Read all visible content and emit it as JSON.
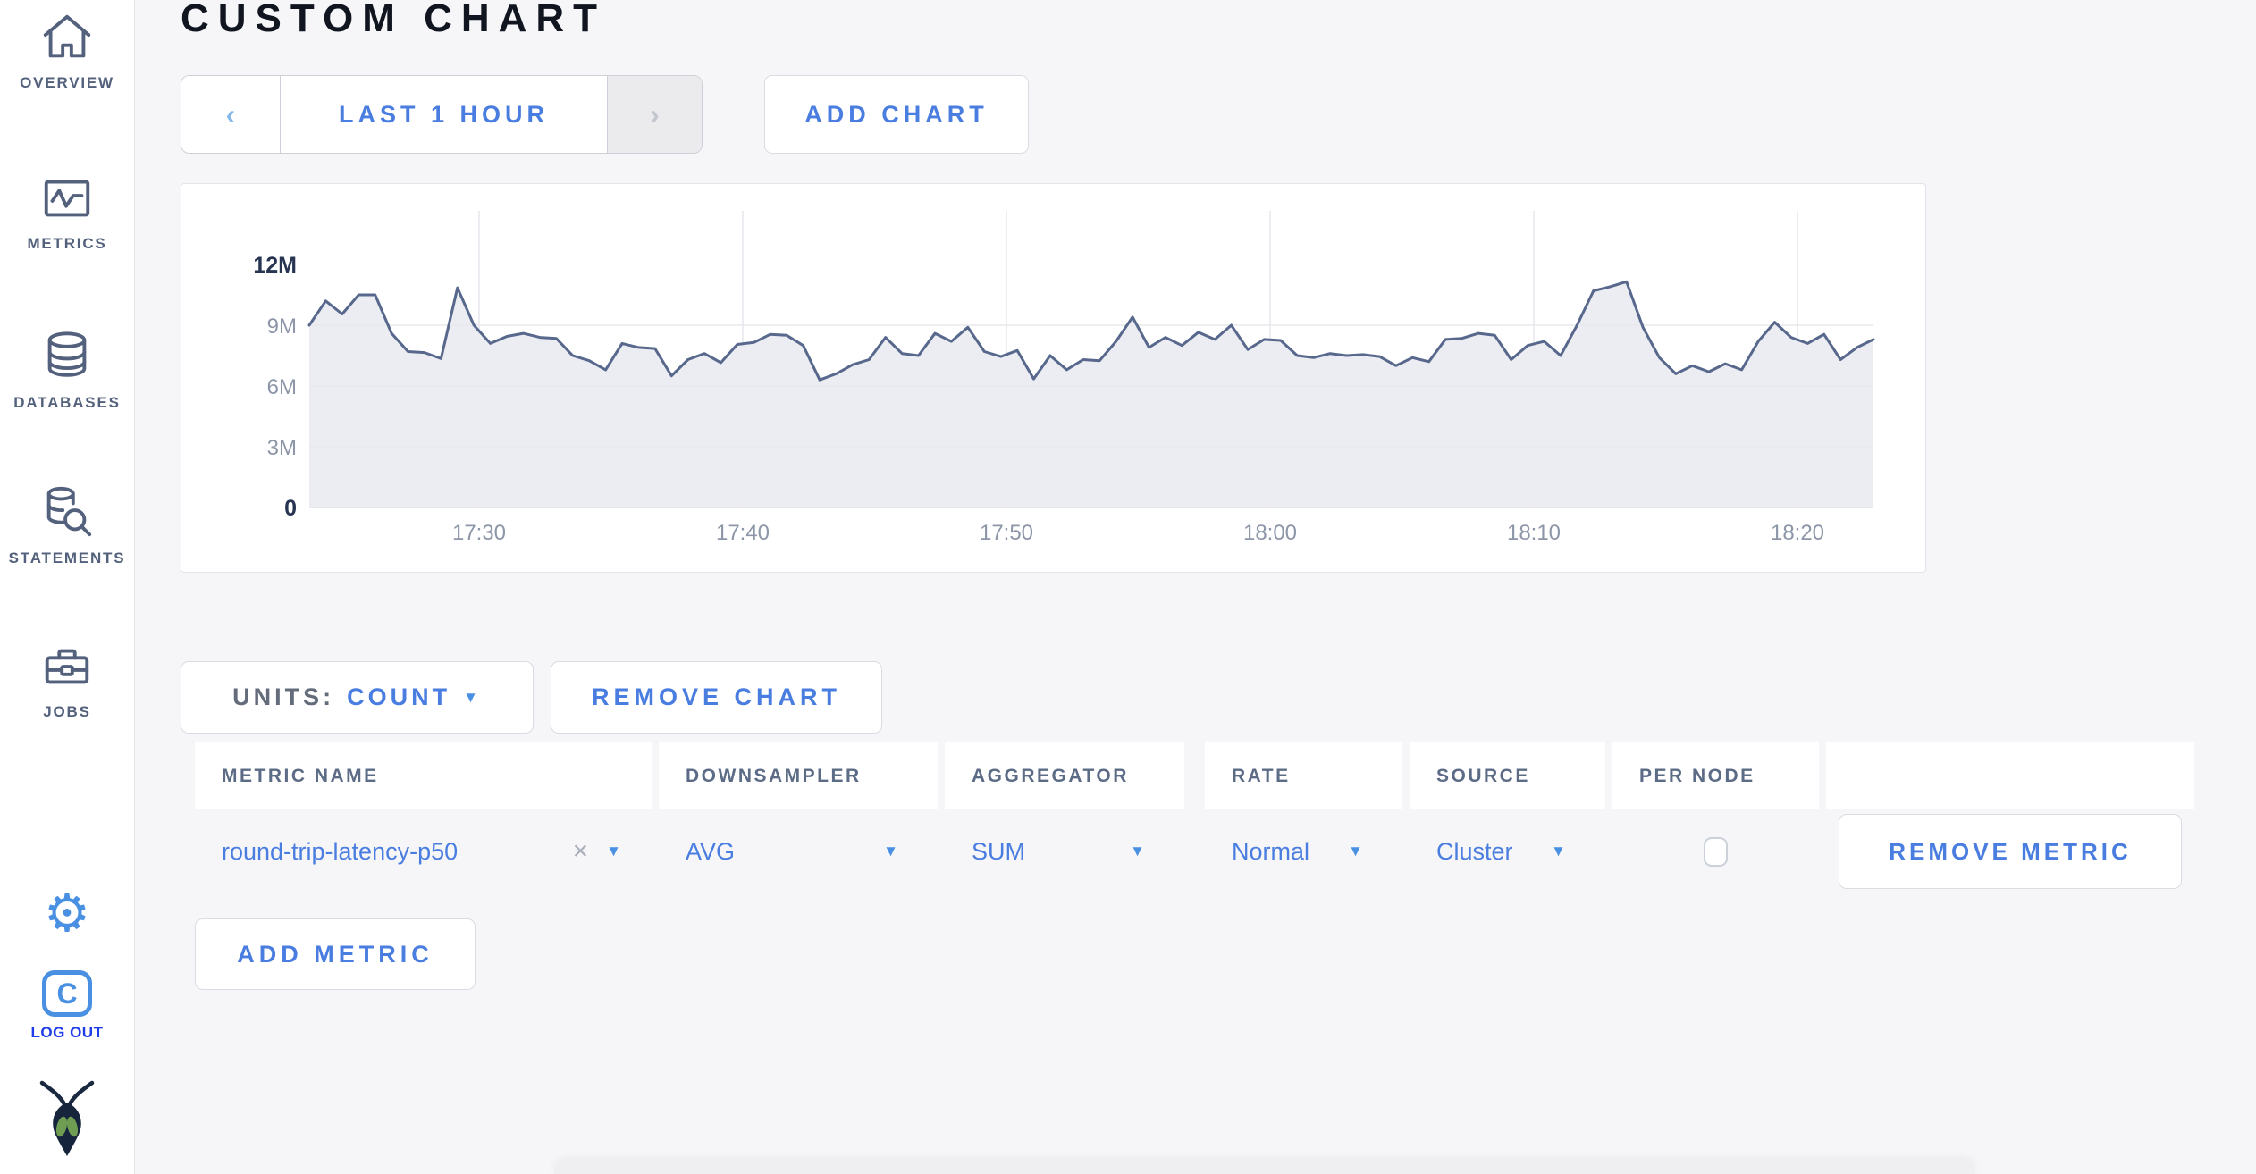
{
  "page_title": "CUSTOM CHART",
  "theme": {
    "accent_blue": "#4a7de0",
    "caret_blue": "#4a90e2",
    "logout_blue": "#1e3ce8",
    "sidebar_icon_gray": "#53617c",
    "chart_line": "#57688c",
    "chart_fill": "#ecedf3"
  },
  "icons": {
    "caret_down": "▼"
  },
  "sidebar": {
    "items": [
      {
        "label": "OVERVIEW",
        "icon": "home-icon"
      },
      {
        "label": "METRICS",
        "icon": "metrics-icon"
      },
      {
        "label": "DATABASES",
        "icon": "database-icon"
      },
      {
        "label": "STATEMENTS",
        "icon": "statements-icon"
      },
      {
        "label": "JOBS",
        "icon": "jobs-icon"
      }
    ],
    "logout": {
      "badge_letter": "C",
      "label": "LOG OUT"
    }
  },
  "toolbar": {
    "prev_arrow": "‹",
    "time_range": "LAST 1 HOUR",
    "next_arrow": "›",
    "add_chart": "ADD CHART"
  },
  "chart_controls": {
    "units_label": "UNITS:",
    "units_value": "COUNT",
    "remove_chart": "REMOVE CHART",
    "add_metric": "ADD METRIC"
  },
  "metrics_table": {
    "columns": [
      "METRIC NAME",
      "DOWNSAMPLER",
      "AGGREGATOR",
      "RATE",
      "SOURCE",
      "PER NODE"
    ],
    "rows": [
      {
        "metric_name": "round-trip-latency-p50",
        "clear": "×",
        "downsampler": "AVG",
        "aggregator": "SUM",
        "rate": "Normal",
        "source": "Cluster",
        "per_node_checked": false,
        "remove_label": "REMOVE METRIC"
      }
    ]
  },
  "chart_data": {
    "type": "area",
    "title": "",
    "legend": "none",
    "grid": true,
    "y_axis": {
      "ticks": [
        "12M",
        "9M",
        "6M",
        "3M",
        "0"
      ],
      "tick_values": [
        12,
        9,
        6,
        3,
        0
      ],
      "range_millions": [
        0,
        12
      ]
    },
    "x_axis": {
      "ticks": [
        "17:30",
        "17:40",
        "17:50",
        "18:00",
        "18:10",
        "18:20"
      ]
    },
    "colors": {
      "line": "#57688c",
      "fill": "#ecedf3"
    },
    "series": [
      {
        "name": "round-trip-latency-p50",
        "unit": "count, millions",
        "values_millions": [
          9.0,
          10.2,
          9.55,
          10.5,
          10.5,
          8.6,
          7.7,
          7.65,
          7.35,
          10.85,
          9.0,
          8.1,
          8.45,
          8.6,
          8.4,
          8.35,
          7.5,
          7.25,
          6.8,
          8.1,
          7.9,
          7.85,
          6.5,
          7.3,
          7.6,
          7.15,
          8.05,
          8.15,
          8.55,
          8.5,
          8.0,
          6.3,
          6.6,
          7.05,
          7.3,
          8.4,
          7.6,
          7.5,
          8.6,
          8.2,
          8.9,
          7.7,
          7.45,
          7.75,
          6.35,
          7.5,
          6.8,
          7.3,
          7.25,
          8.2,
          9.4,
          7.9,
          8.4,
          8.0,
          8.65,
          8.3,
          9.0,
          7.8,
          8.3,
          8.25,
          7.5,
          7.4,
          7.6,
          7.5,
          7.55,
          7.45,
          7.0,
          7.4,
          7.2,
          8.3,
          8.35,
          8.6,
          8.5,
          7.3,
          8.0,
          8.2,
          7.5,
          9.0,
          10.7,
          10.9,
          11.15,
          8.9,
          7.4,
          6.6,
          7.0,
          6.7,
          7.1,
          6.8,
          8.2,
          9.15,
          8.4,
          8.1,
          8.55,
          7.3,
          7.9,
          8.3
        ]
      }
    ]
  }
}
